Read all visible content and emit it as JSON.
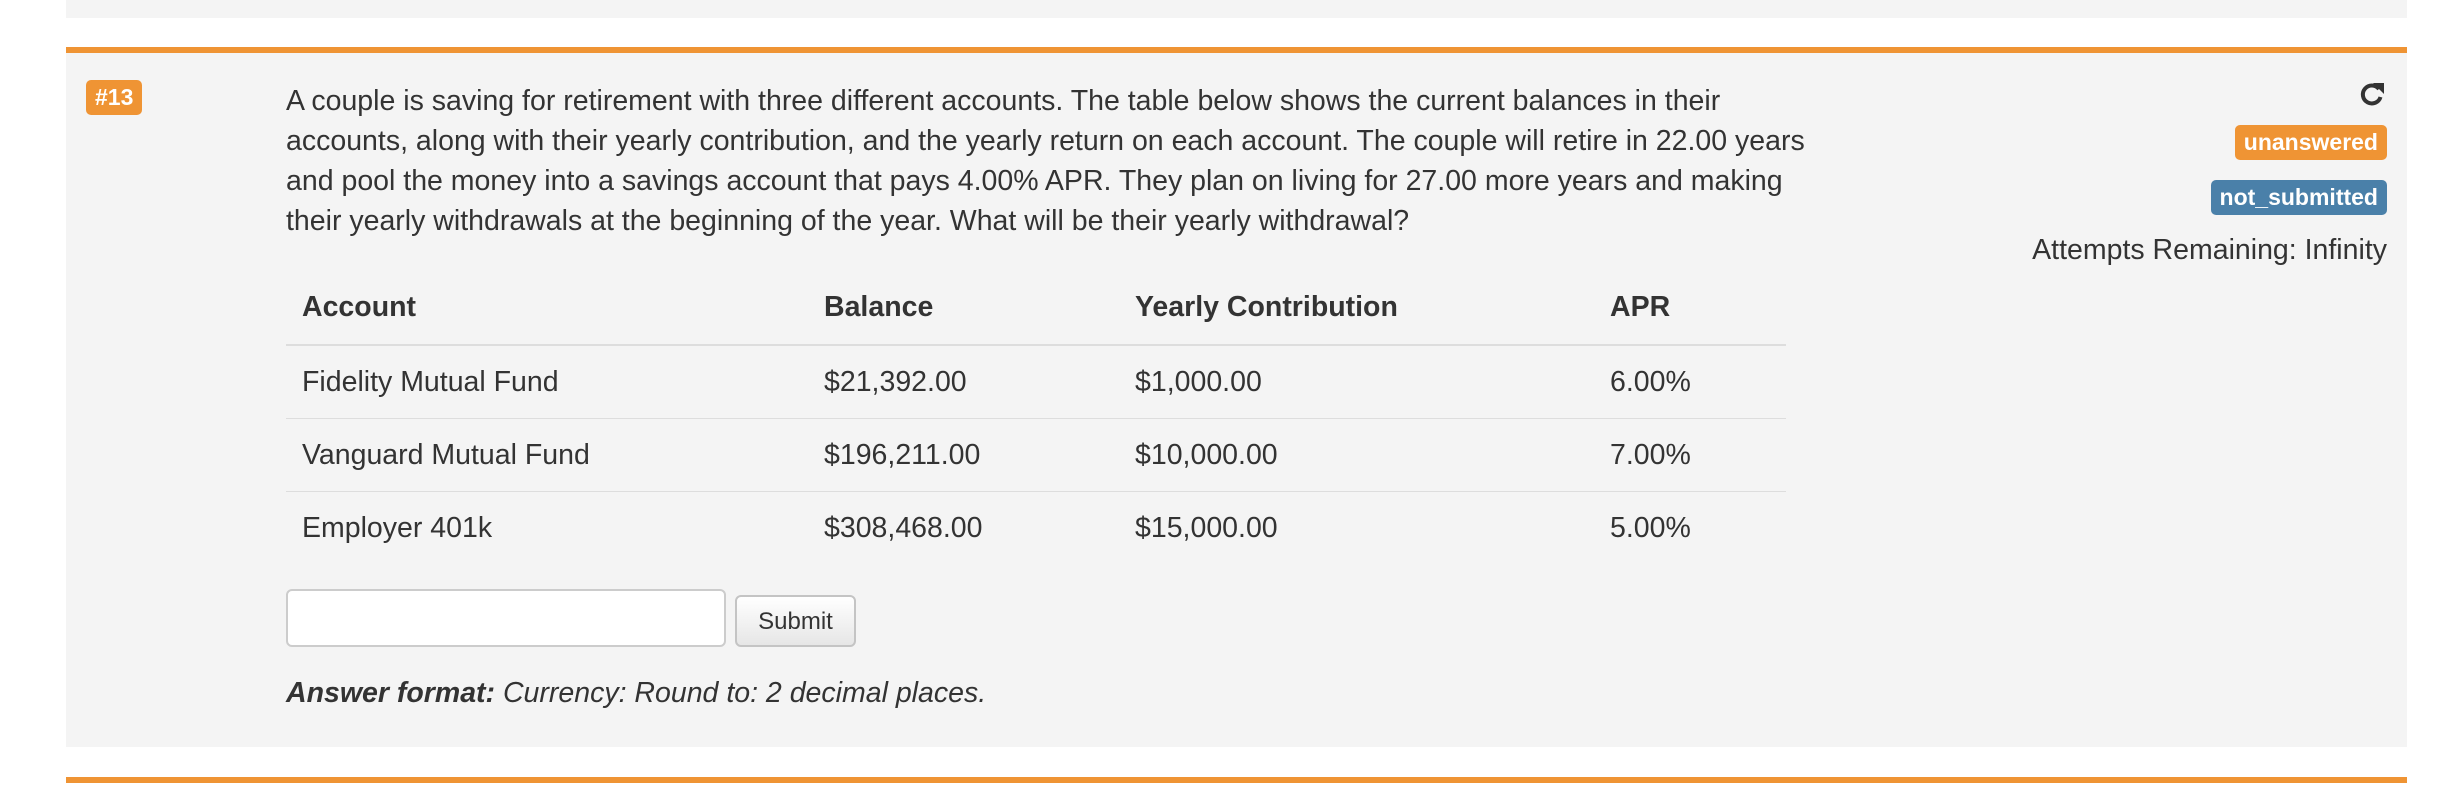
{
  "question": {
    "number": "#13",
    "text": "A couple is saving for retirement with three different accounts. The table below shows the current balances in their accounts, along with their yearly contribution, and the yearly return on each account. The couple will retire in 22.00 years and pool the money into a savings account that pays 4.00% APR. They plan on living for 27.00 more years and making their yearly withdrawals at the beginning of the year. What will be their yearly withdrawal?",
    "table": {
      "headers": [
        "Account",
        "Balance",
        "Yearly Contribution",
        "APR"
      ],
      "rows": [
        [
          "Fidelity Mutual Fund",
          "$21,392.00",
          "$1,000.00",
          "6.00%"
        ],
        [
          "Vanguard Mutual Fund",
          "$196,211.00",
          "$10,000.00",
          "7.00%"
        ],
        [
          "Employer 401k",
          "$308,468.00",
          "$15,000.00",
          "5.00%"
        ]
      ]
    },
    "answer": {
      "value": "",
      "placeholder": "",
      "submit_label": "Submit",
      "format_label": "Answer format:",
      "format_text": " Currency: Round to: 2 decimal places."
    }
  },
  "status": {
    "redo_icon": "redo-icon",
    "answer_state": "unanswered",
    "submission_state": "not_submitted",
    "attempts": "Attempts Remaining: Infinity"
  },
  "colors": {
    "accent": "#ef9434",
    "info": "#4a80a9",
    "card_background": "#f4f4f4"
  }
}
